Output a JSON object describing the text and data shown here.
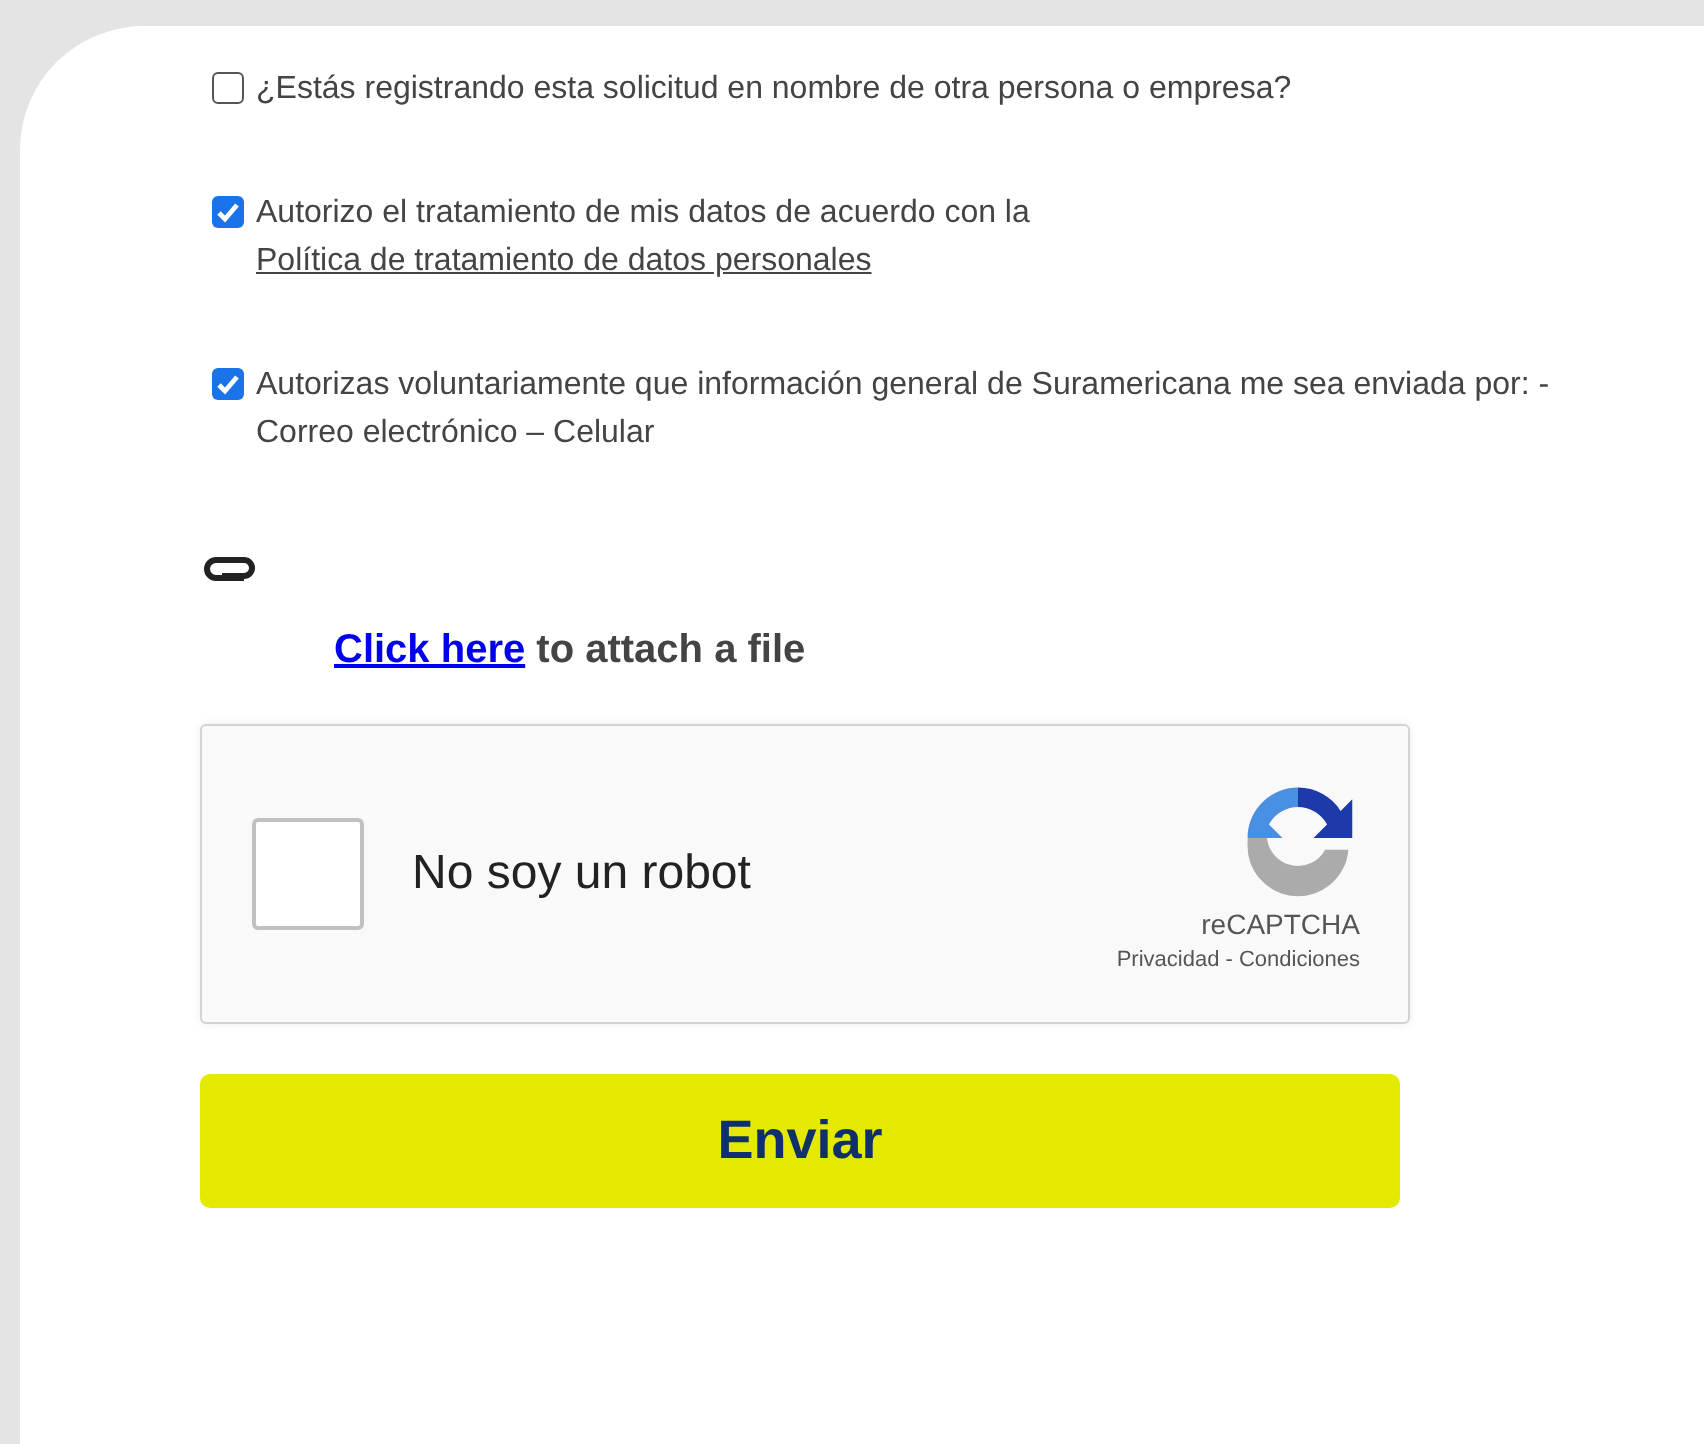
{
  "consents": [
    {
      "text": "¿Estás registrando esta solicitud en nombre de otra persona o empresa?",
      "checked": false
    },
    {
      "text": "Autorizo el tratamiento de mis datos de acuerdo con la",
      "link": "Política de tratamiento de datos personales",
      "checked": true
    },
    {
      "text": "Autorizas voluntariamente que información general de Suramericana me sea enviada por: -Correo electrónico – Celular",
      "checked": true
    }
  ],
  "attachment": {
    "link": "Click here",
    "text": "to attach a file"
  },
  "captcha": {
    "label": "No soy un robot",
    "checked": false,
    "brand": "reCAPTCHA",
    "links": "Privacidad - Condiciones"
  },
  "submit": "Enviar"
}
